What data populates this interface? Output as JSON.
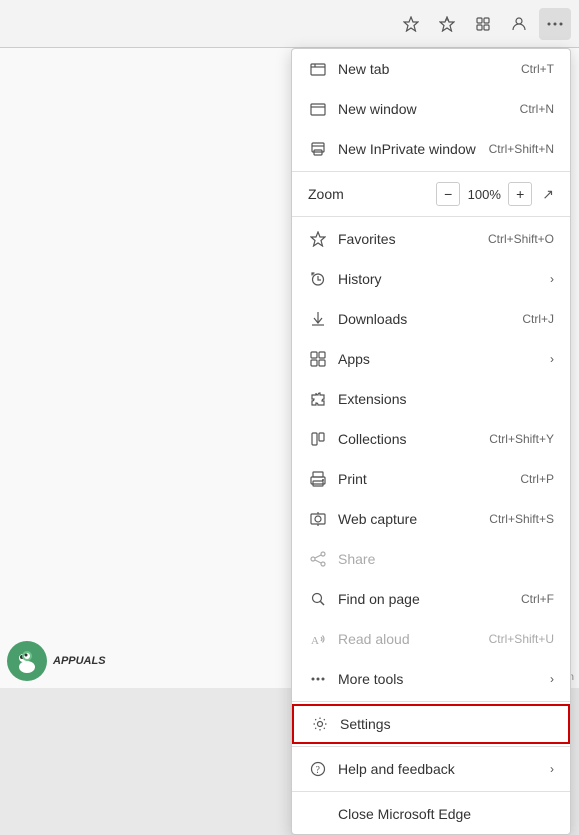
{
  "toolbar": {
    "buttons": [
      "favorites-star",
      "reading-list",
      "collections",
      "profile",
      "more-options"
    ]
  },
  "menu": {
    "items": [
      {
        "id": "new-tab",
        "label": "New tab",
        "shortcut": "Ctrl+T",
        "icon": "newtab",
        "arrow": false,
        "disabled": false
      },
      {
        "id": "new-window",
        "label": "New window",
        "shortcut": "Ctrl+N",
        "icon": "window",
        "arrow": false,
        "disabled": false
      },
      {
        "id": "new-inprivate",
        "label": "New InPrivate window",
        "shortcut": "Ctrl+Shift+N",
        "icon": "inprivate",
        "arrow": false,
        "disabled": false
      },
      {
        "id": "zoom-divider",
        "type": "divider"
      },
      {
        "id": "zoom",
        "label": "Zoom",
        "type": "zoom",
        "value": "100%",
        "disabled": false
      },
      {
        "id": "zoom-divider2",
        "type": "divider"
      },
      {
        "id": "favorites",
        "label": "Favorites",
        "shortcut": "Ctrl+Shift+O",
        "icon": "favorites",
        "arrow": false,
        "disabled": false
      },
      {
        "id": "history",
        "label": "History",
        "shortcut": "",
        "icon": "history",
        "arrow": true,
        "disabled": false
      },
      {
        "id": "downloads",
        "label": "Downloads",
        "shortcut": "Ctrl+J",
        "icon": "downloads",
        "arrow": false,
        "disabled": false
      },
      {
        "id": "apps",
        "label": "Apps",
        "shortcut": "",
        "icon": "apps",
        "arrow": true,
        "disabled": false
      },
      {
        "id": "extensions",
        "label": "Extensions",
        "shortcut": "",
        "icon": "extensions",
        "arrow": false,
        "disabled": false
      },
      {
        "id": "collections",
        "label": "Collections",
        "shortcut": "Ctrl+Shift+Y",
        "icon": "collections",
        "arrow": false,
        "disabled": false
      },
      {
        "id": "print",
        "label": "Print",
        "shortcut": "Ctrl+P",
        "icon": "print",
        "arrow": false,
        "disabled": false
      },
      {
        "id": "webcapture",
        "label": "Web capture",
        "shortcut": "Ctrl+Shift+S",
        "icon": "webcapture",
        "arrow": false,
        "disabled": false
      },
      {
        "id": "share",
        "label": "Share",
        "shortcut": "",
        "icon": "share",
        "arrow": false,
        "disabled": true
      },
      {
        "id": "findonpage",
        "label": "Find on page",
        "shortcut": "Ctrl+F",
        "icon": "find",
        "arrow": false,
        "disabled": false
      },
      {
        "id": "readaloud",
        "label": "Read aloud",
        "shortcut": "Ctrl+Shift+U",
        "icon": "readaloud",
        "arrow": false,
        "disabled": true
      },
      {
        "id": "moretools",
        "label": "More tools",
        "shortcut": "",
        "icon": "moretools",
        "arrow": true,
        "disabled": false
      },
      {
        "id": "settings-divider",
        "type": "divider"
      },
      {
        "id": "settings",
        "label": "Settings",
        "shortcut": "",
        "icon": "settings",
        "arrow": false,
        "disabled": false,
        "highlighted": true
      },
      {
        "id": "help-divider",
        "type": "divider"
      },
      {
        "id": "help",
        "label": "Help and feedback",
        "shortcut": "",
        "icon": "help",
        "arrow": true,
        "disabled": false
      },
      {
        "id": "close-divider",
        "type": "divider"
      },
      {
        "id": "close",
        "label": "Close Microsoft Edge",
        "shortcut": "",
        "icon": "",
        "arrow": false,
        "disabled": false
      }
    ]
  }
}
